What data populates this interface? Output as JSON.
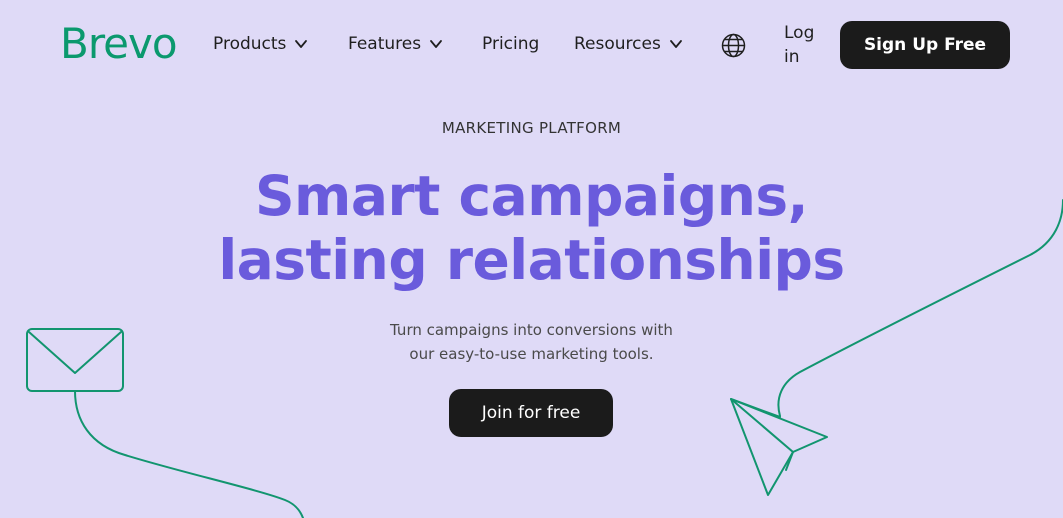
{
  "brand": {
    "logo_text": "Brevo",
    "logo_color": "#0b996e"
  },
  "nav": {
    "products": "Products",
    "features": "Features",
    "pricing": "Pricing",
    "resources": "Resources",
    "language_icon": "globe-icon",
    "login": "Log in",
    "signup": "Sign Up Free"
  },
  "hero": {
    "eyebrow": "MARKETING PLATFORM",
    "headline_line1": "Smart campaigns,",
    "headline_line2": "lasting relationships",
    "subtext_line1": "Turn campaigns into conversions with",
    "subtext_line2": "our easy-to-use marketing tools.",
    "cta": "Join for free"
  },
  "colors": {
    "background": "#dfdaf7",
    "headline": "#6a5bdc",
    "button_bg": "#1b1b1b",
    "illustration_stroke": "#12956f"
  },
  "illustrations": {
    "left": "envelope-icon",
    "right": "paper-plane-icon"
  }
}
